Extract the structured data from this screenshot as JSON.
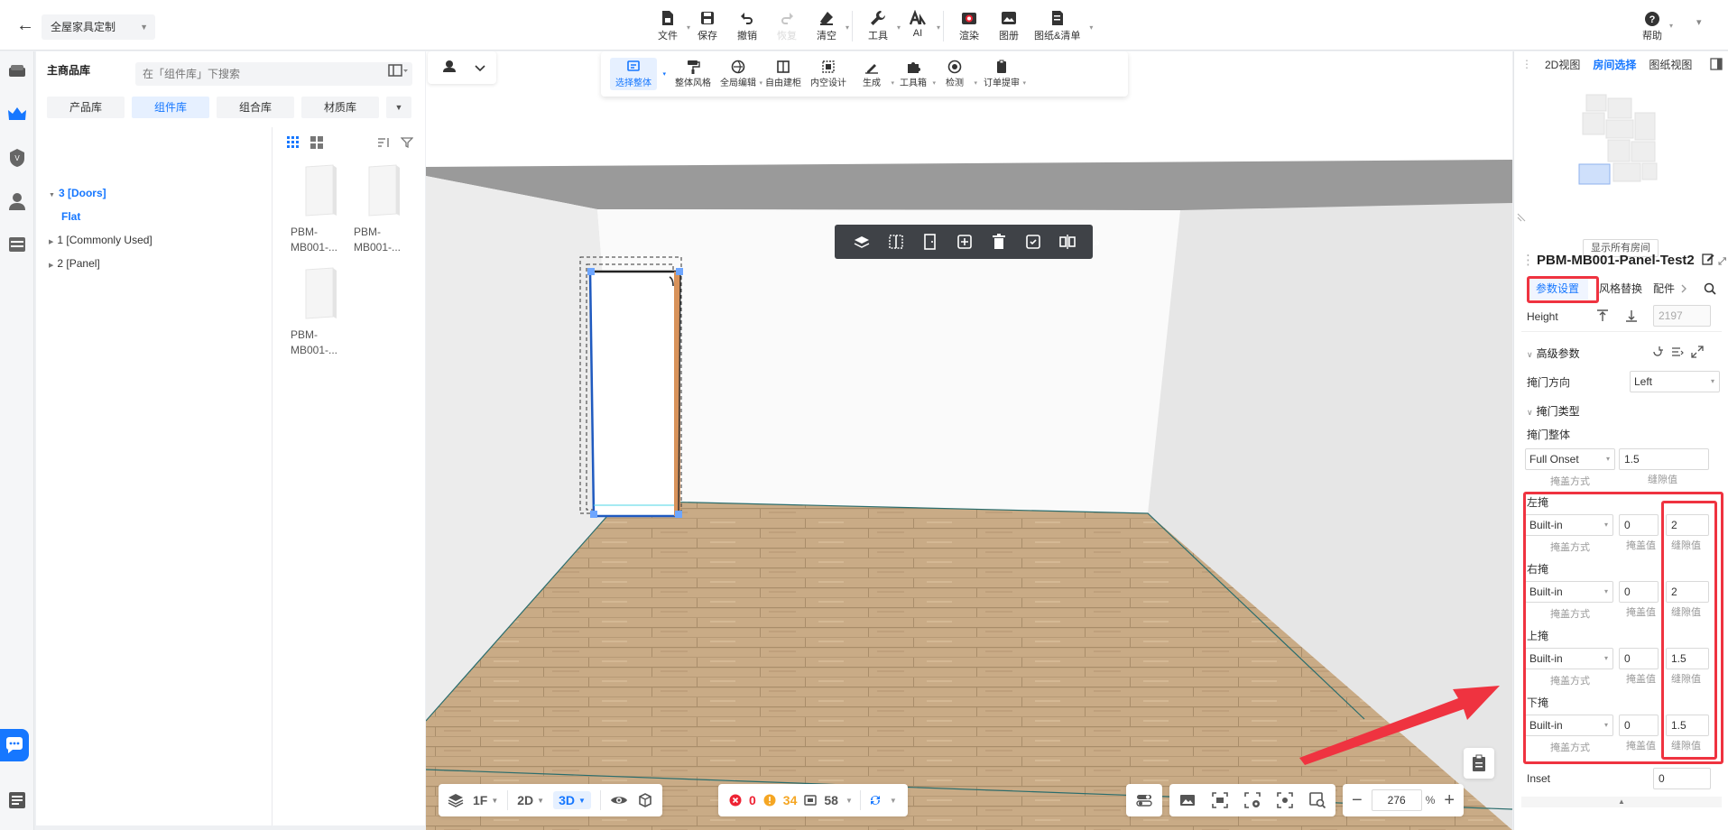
{
  "topbar": {
    "project_name": "全屋家具定制",
    "tools": [
      {
        "label": "文件"
      },
      {
        "label": "保存"
      },
      {
        "label": "撤销"
      },
      {
        "label": "恢复"
      },
      {
        "label": "清空"
      },
      {
        "label": "工具"
      },
      {
        "label": "AI"
      },
      {
        "label": "渲染"
      },
      {
        "label": "图册"
      },
      {
        "label": "图纸&清单"
      }
    ],
    "help_label": "帮助"
  },
  "library": {
    "title": "主商品库",
    "search_placeholder": "在「组件库」下搜索",
    "tabs": [
      "产品库",
      "组件库",
      "组合库",
      "材质库"
    ],
    "active_tab": "组件库",
    "tree": {
      "doors": "3 [Doors]",
      "flat": "Flat",
      "common": "1 [Commonly Used]",
      "panel": "2 [Panel]"
    },
    "thumbs": [
      {
        "name_line1": "PBM-",
        "name_line2": "MB001-..."
      },
      {
        "name_line1": "PBM-",
        "name_line2": "MB001-..."
      },
      {
        "name_line1": "PBM-",
        "name_line2": "MB001-..."
      }
    ]
  },
  "viewport_toolbar": {
    "items": [
      {
        "label": "选择整体"
      },
      {
        "label": "整体风格"
      },
      {
        "label": "全局编辑"
      },
      {
        "label": "自由建柜"
      },
      {
        "label": "内空设计"
      },
      {
        "label": "生成"
      },
      {
        "label": "工具箱"
      },
      {
        "label": "检测"
      },
      {
        "label": "订单提审"
      }
    ]
  },
  "viewport_bottom": {
    "floor": "1F",
    "view_2d": "2D",
    "view_3d": "3D",
    "errors": "0",
    "warnings": "34",
    "items": "58",
    "zoom": "276",
    "zoom_unit": "%"
  },
  "right_panel": {
    "tabs": [
      "2D视图",
      "房间选择",
      "图纸视图"
    ],
    "active_tab": "房间选择",
    "show_all_rooms": "显示所有房间",
    "object_title": "PBM-MB001-Panel-Test2",
    "param_tabs": [
      "参数设置",
      "风格替换",
      "配件"
    ],
    "height_label": "Height",
    "height_value": "2197",
    "advanced_title": "高级参数",
    "door_dir_label": "掩门方向",
    "door_dir_value": "Left",
    "door_type_title": "掩门类型",
    "door_whole_label": "掩门整体",
    "door_whole_value": "Full Onset",
    "door_whole_gap": "1.5",
    "hint_method": "掩盖方式",
    "hint_cover": "掩盖值",
    "hint_gap": "缝隙值",
    "sides": [
      {
        "label": "左掩",
        "method": "Built-in",
        "cover": "0",
        "gap": "2"
      },
      {
        "label": "右掩",
        "method": "Built-in",
        "cover": "0",
        "gap": "2"
      },
      {
        "label": "上掩",
        "method": "Built-in",
        "cover": "0",
        "gap": "1.5"
      },
      {
        "label": "下掩",
        "method": "Built-in",
        "cover": "0",
        "gap": "1.5"
      }
    ],
    "inset_label": "Inset",
    "inset_value": "0"
  }
}
